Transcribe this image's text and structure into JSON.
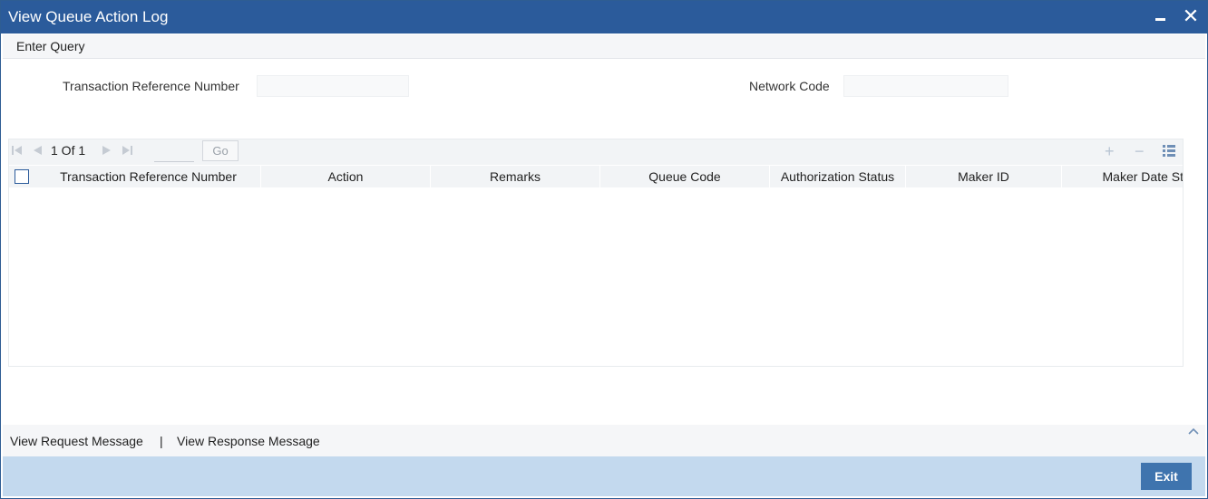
{
  "window": {
    "title": "View Queue Action Log"
  },
  "menu": {
    "enter_query": "Enter Query"
  },
  "form": {
    "txn_ref_label": "Transaction Reference Number",
    "txn_ref_value": "",
    "network_code_label": "Network Code",
    "network_code_value": ""
  },
  "grid": {
    "pager_text": "1 Of 1",
    "page_input_value": "",
    "go_label": "Go",
    "columns": [
      "Transaction Reference Number",
      "Action",
      "Remarks",
      "Queue Code",
      "Authorization Status",
      "Maker ID",
      "Maker Date St"
    ],
    "rows": []
  },
  "footer": {
    "view_request": "View Request Message",
    "separator": "|",
    "view_response": "View Response Message",
    "exit_label": "Exit"
  },
  "icons": {
    "first_page": "first-page-icon",
    "prev_page": "previous-page-icon",
    "next_page": "next-page-icon",
    "last_page": "last-page-icon",
    "add_row": "add-row-icon",
    "delete_row": "delete-row-icon",
    "single_view": "list-view-icon",
    "collapse": "chevron-up-icon",
    "minimize": "minimize-icon",
    "close": "close-icon"
  },
  "colors": {
    "title_bar": "#2b5b9b",
    "bottom_bar": "#c3d9ee",
    "exit_button": "#3f74ae"
  }
}
